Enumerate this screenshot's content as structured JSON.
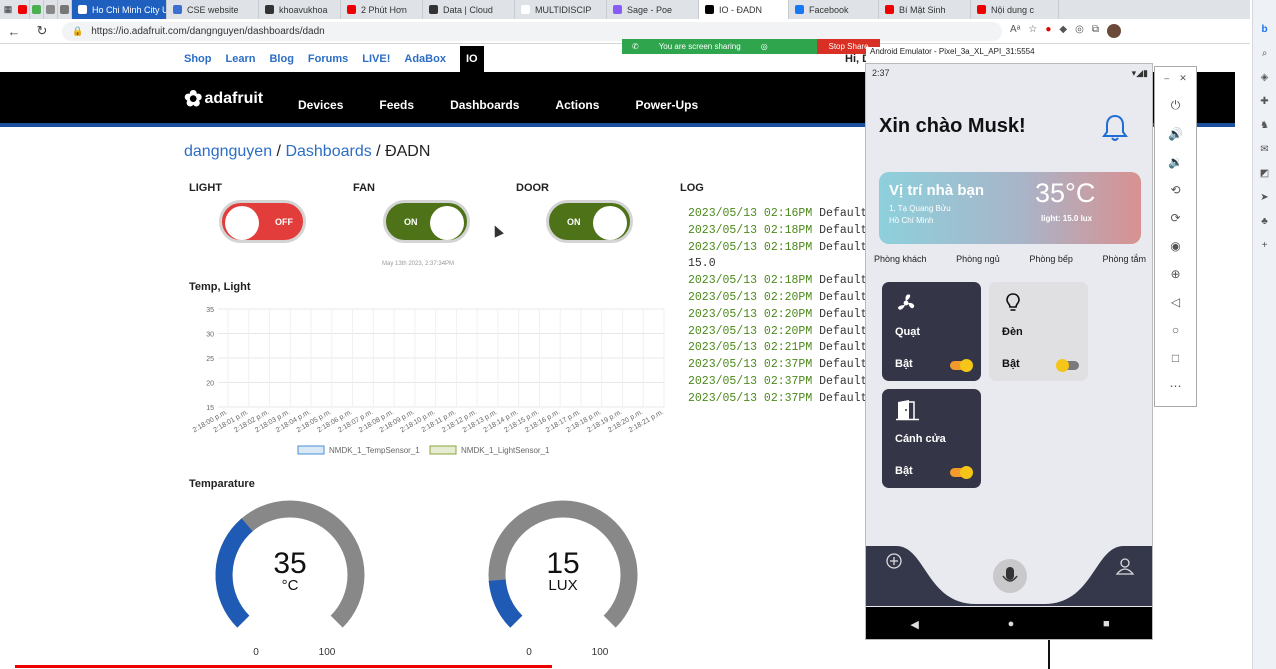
{
  "browser": {
    "tabs": [
      {
        "label": "",
        "color": "#e00"
      },
      {
        "label": "",
        "color": "#4caf50"
      },
      {
        "label": "",
        "color": "#888"
      },
      {
        "label": "",
        "color": "#777"
      },
      {
        "label": "Ho Chi Minh City Univ",
        "color": "#fff",
        "style": "blue"
      },
      {
        "label": "CSE website",
        "color": "#3b6fd1"
      },
      {
        "label": "khoavukhoa",
        "color": "#333"
      },
      {
        "label": "2 Phút Hơn",
        "color": "#e00"
      },
      {
        "label": "Data | Cloud",
        "color": "#333"
      },
      {
        "label": "MULTIDISCIP",
        "color": "#fff"
      },
      {
        "label": "Sage - Poe",
        "color": "#8a5cf6"
      },
      {
        "label": "IO - ĐADN",
        "color": "#000",
        "style": "active"
      },
      {
        "label": "Facebook",
        "color": "#1877f2"
      },
      {
        "label": "Bí Mật Sinh",
        "color": "#e00"
      },
      {
        "label": "Nội dung c",
        "color": "#e00"
      }
    ],
    "url": "https://io.adafruit.com/dangnguyen/dashboards/dadn"
  },
  "share": {
    "text": "You are screen sharing",
    "stop": "Stop Share"
  },
  "adafruit": {
    "top_links": [
      "Shop",
      "Learn",
      "Blog",
      "Forums",
      "LIVE!",
      "AdaBox"
    ],
    "io_label": "IO",
    "greeting": "Hi, D",
    "logo": "adafruit",
    "nav": [
      "Devices",
      "Feeds",
      "Dashboards",
      "Actions",
      "Power-Ups"
    ],
    "breadcrumb": {
      "user": "dangnguyen",
      "sep1": " / ",
      "section": "Dashboards",
      "sep2": " / ",
      "page": "ĐADN"
    }
  },
  "blocks": {
    "light": {
      "title": "LIGHT",
      "state": "OFF"
    },
    "fan": {
      "title": "FAN",
      "state": "ON",
      "timestamp": "May 13th 2023, 2:37:34PM"
    },
    "door": {
      "title": "DOOR",
      "state": "ON"
    },
    "log": {
      "title": "LOG",
      "rows": [
        {
          "ts": "2023/05/13 02:16PM",
          "msg": "Default N"
        },
        {
          "ts": "2023/05/13 02:18PM",
          "msg": "Default N"
        },
        {
          "ts": "2023/05/13 02:18PM",
          "msg": "Default N"
        },
        {
          "ts": "15.0",
          "msg": ""
        },
        {
          "ts": "2023/05/13 02:18PM",
          "msg": "Default N"
        },
        {
          "ts": "2023/05/13 02:20PM",
          "msg": "Default N"
        },
        {
          "ts": "2023/05/13 02:20PM",
          "msg": "Default N"
        },
        {
          "ts": "2023/05/13 02:20PM",
          "msg": "Default N"
        },
        {
          "ts": "2023/05/13 02:21PM",
          "msg": "Default N"
        },
        {
          "ts": "2023/05/13 02:37PM",
          "msg": "Default N"
        },
        {
          "ts": "2023/05/13 02:37PM",
          "msg": "Default N"
        },
        {
          "ts": "2023/05/13 02:37PM",
          "msg": "Default N"
        }
      ]
    },
    "chart_title": "Temp, Light",
    "gauge_title": "Temparature"
  },
  "chart_data": [
    {
      "type": "line",
      "title": "Temp, Light",
      "x": [
        "2:18:00 p.m.",
        "2:18:01 p.m.",
        "2:18:02 p.m.",
        "2:18:03 p.m.",
        "2:18:04 p.m.",
        "2:18:05 p.m.",
        "2:18:06 p.m.",
        "2:18:07 p.m.",
        "2:18:08 p.m.",
        "2:18:09 p.m.",
        "2:18:10 p.m.",
        "2:18:11 p.m.",
        "2:18:12 p.m.",
        "2:18:13 p.m.",
        "2:18:14 p.m.",
        "2:18:15 p.m.",
        "2:18:16 p.m.",
        "2:18:17 p.m.",
        "2:18:18 p.m.",
        "2:18:19 p.m.",
        "2:18:20 p.m.",
        "2:18:21 p.m."
      ],
      "yticks": [
        35,
        30,
        25,
        20,
        15
      ],
      "ylim": [
        15,
        35
      ],
      "series": [
        {
          "name": "NMDK_1_TempSensor_1",
          "color": "#4a90d9",
          "values": []
        },
        {
          "name": "NMDK_1_LightSensor_1",
          "color": "#8aa53a",
          "values": []
        }
      ],
      "legend": "bottom",
      "grid": true
    },
    {
      "type": "gauge",
      "value": 35,
      "unit": "°C",
      "min": 0,
      "max": 100,
      "min_label": "0",
      "max_label": "100",
      "fill": "#1f5bb5",
      "track": "#888888"
    },
    {
      "type": "gauge",
      "value": 15,
      "unit": "LUX",
      "min": 0,
      "max": 100,
      "min_label": "0",
      "max_label": "100",
      "fill": "#1f5bb5",
      "track": "#888888"
    }
  ],
  "emulator": {
    "title": "Android Emulator - Pixel_3a_XL_API_31:5554",
    "time": "2:37",
    "greeting": "Xin chào Musk!",
    "weather": {
      "place": "Vị trí nhà bạn",
      "addr1": "1, Tạ Quang Bửu",
      "addr2": "Hồ Chí Minh",
      "temp": "35°C",
      "light": "light: 15.0 lux"
    },
    "rooms": [
      "Phòng khách",
      "Phòng ngủ",
      "Phòng bếp",
      "Phòng tắm"
    ],
    "devices": [
      {
        "name": "Quạt",
        "state": "Bật",
        "icon": "fan-icon",
        "on": true
      },
      {
        "name": "Đèn",
        "state": "Bật",
        "icon": "bulb-icon",
        "on": false
      },
      {
        "name": "Cánh cửa",
        "state": "Bật",
        "icon": "door-icon",
        "on": true
      }
    ]
  }
}
